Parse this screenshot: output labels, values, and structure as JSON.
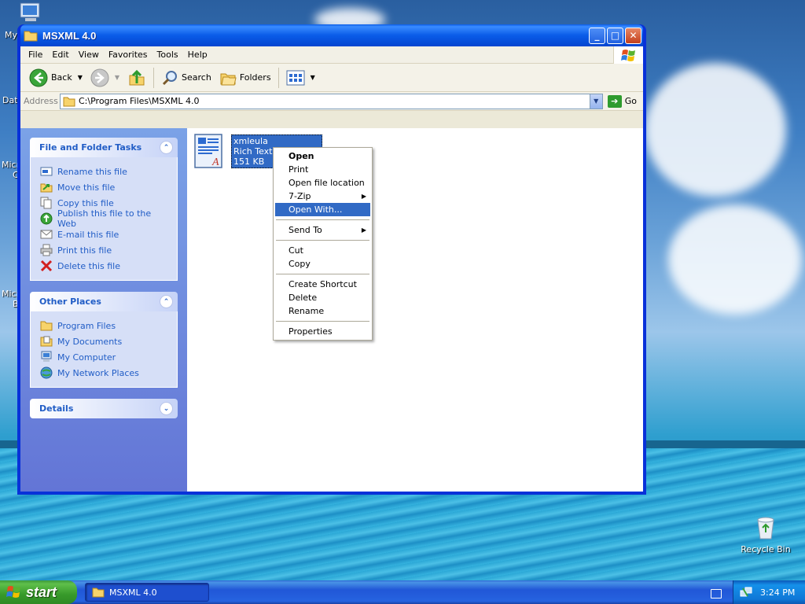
{
  "desktop": {
    "left_labels": [
      "My",
      "Dat",
      "Micro",
      "C",
      "Micro",
      "B"
    ],
    "recycle_bin_label": "Recycle Bin"
  },
  "window": {
    "title": "MSXML 4.0",
    "menu": [
      "File",
      "Edit",
      "View",
      "Favorites",
      "Tools",
      "Help"
    ],
    "toolbar": {
      "back_label": "Back",
      "search_label": "Search",
      "folders_label": "Folders"
    },
    "address": {
      "label": "Address",
      "value": "C:\\Program Files\\MSXML 4.0",
      "go_label": "Go"
    },
    "taskpane": {
      "file_tasks": {
        "title": "File and Folder Tasks",
        "items": [
          {
            "label": "Rename this file",
            "icon": "rename-icon"
          },
          {
            "label": "Move this file",
            "icon": "move-icon"
          },
          {
            "label": "Copy this file",
            "icon": "copy-icon"
          },
          {
            "label": "Publish this file to the Web",
            "icon": "publish-web-icon"
          },
          {
            "label": "E-mail this file",
            "icon": "email-icon"
          },
          {
            "label": "Print this file",
            "icon": "print-icon"
          },
          {
            "label": "Delete this file",
            "icon": "delete-icon"
          }
        ]
      },
      "other_places": {
        "title": "Other Places",
        "items": [
          {
            "label": "Program Files",
            "icon": "folder-icon"
          },
          {
            "label": "My Documents",
            "icon": "my-documents-icon"
          },
          {
            "label": "My Computer",
            "icon": "my-computer-icon"
          },
          {
            "label": "My Network Places",
            "icon": "network-places-icon"
          }
        ]
      },
      "details": {
        "title": "Details"
      }
    },
    "file": {
      "name": "xmleula",
      "type": "Rich Text Document",
      "size": "151 KB"
    },
    "context_menu": {
      "items": [
        "Open",
        "Print",
        "Open file location",
        "7-Zip",
        "Open With...",
        "Send To",
        "Cut",
        "Copy",
        "Create Shortcut",
        "Delete",
        "Rename",
        "Properties"
      ],
      "highlighted": "Open With..."
    }
  },
  "taskbar": {
    "start_label": "start",
    "task_item": "MSXML 4.0",
    "clock": "3:24 PM"
  },
  "colors": {
    "xp_blue": "#0831d9",
    "selection": "#316ac5",
    "start_green": "#379a2a",
    "link_blue": "#215dc6"
  }
}
